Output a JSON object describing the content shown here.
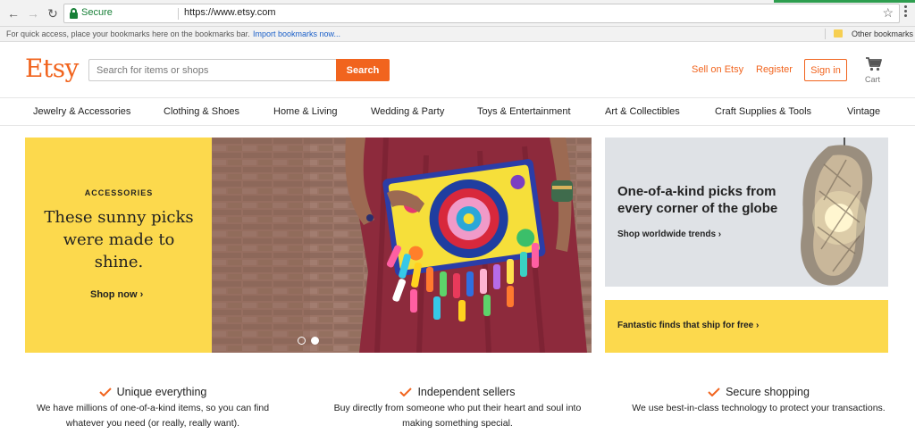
{
  "browser": {
    "secure_label": "Secure",
    "url": "https://www.etsy.com",
    "bookmarks_hint": "For quick access, place your bookmarks here on the bookmarks bar.",
    "import_link": "Import bookmarks now...",
    "other_bookmarks": "Other bookmarks"
  },
  "header": {
    "logo": "Etsy",
    "search_placeholder": "Search for items or shops",
    "search_button": "Search",
    "sell_link": "Sell on Etsy",
    "register_link": "Register",
    "signin_button": "Sign in",
    "cart_label": "Cart"
  },
  "categories": [
    "Jewelry & Accessories",
    "Clothing & Shoes",
    "Home & Living",
    "Wedding & Party",
    "Toys & Entertainment",
    "Art & Collectibles",
    "Craft Supplies & Tools",
    "Vintage"
  ],
  "hero": {
    "eyebrow": "ACCESSORIES",
    "headline": "These sunny picks were made to shine.",
    "cta": "Shop now ›",
    "slides_total": 2,
    "slide_active": 2
  },
  "promo": {
    "title": "One-of-a-kind picks from every corner of the globe",
    "cta": "Shop worldwide trends ›"
  },
  "free_shipping": {
    "text": "Fantastic finds that ship for free ›"
  },
  "value_props": [
    {
      "title": "Unique everything",
      "body": "We have millions of one-of-a-kind items, so you can find whatever you need (or really, really want)."
    },
    {
      "title": "Independent sellers",
      "body": "Buy directly from someone who put their heart and soul into making something special."
    },
    {
      "title": "Secure shopping",
      "body": "We use best-in-class technology to protect your transactions."
    }
  ],
  "colors": {
    "brand_orange": "#f1641e",
    "accent_yellow": "#fcd94d",
    "secure_green": "#188038"
  }
}
